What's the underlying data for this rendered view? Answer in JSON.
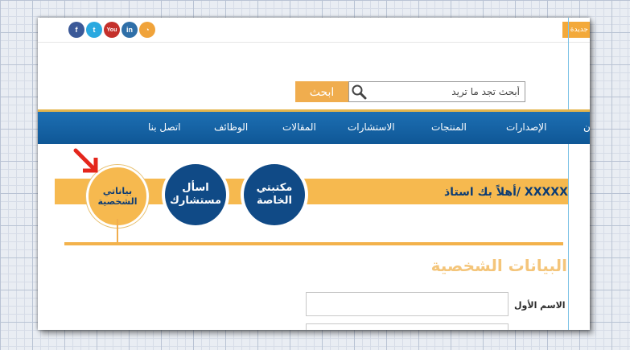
{
  "header": {
    "new_badge": "جديدة",
    "social": [
      {
        "icon": "facebook-icon",
        "glyph": "f",
        "color": "#3b5998"
      },
      {
        "icon": "twitter-icon",
        "glyph": "t",
        "color": "#2aa9e0"
      },
      {
        "icon": "youtube-icon",
        "glyph": "You",
        "color": "#c4302b"
      },
      {
        "icon": "linkedin-icon",
        "glyph": "in",
        "color": "#2f6fa8"
      },
      {
        "icon": "rss-icon",
        "glyph": "◔",
        "color": "#f0a33a"
      }
    ]
  },
  "search": {
    "button_label": "ابحث",
    "placeholder": "أبحث تجد ما تريد",
    "value": ""
  },
  "nav": {
    "items": [
      "الإصدارات",
      "المنتجات",
      "الاستشارات",
      "المقالات",
      "الوظائف",
      "اتصل بنا"
    ],
    "clipped_item": "ن"
  },
  "profile": {
    "welcome": "أهلاً بك استاذ/ XXXXX",
    "circles": [
      {
        "line1": "مكتبتي",
        "line2": "الخاصة"
      },
      {
        "line1": "اسأل",
        "line2": "مستشارك"
      },
      {
        "line1": "بياناتي",
        "line2": "الشخصية"
      }
    ]
  },
  "form": {
    "section_title": "البيانات الشخصية",
    "first_name_label": "الاسم الأول",
    "first_name_value": "",
    "second_field_value": ""
  },
  "colors": {
    "nav_blue": "#1565a8",
    "accent_orange": "#f6b94f",
    "dark_blue": "#104a86"
  }
}
